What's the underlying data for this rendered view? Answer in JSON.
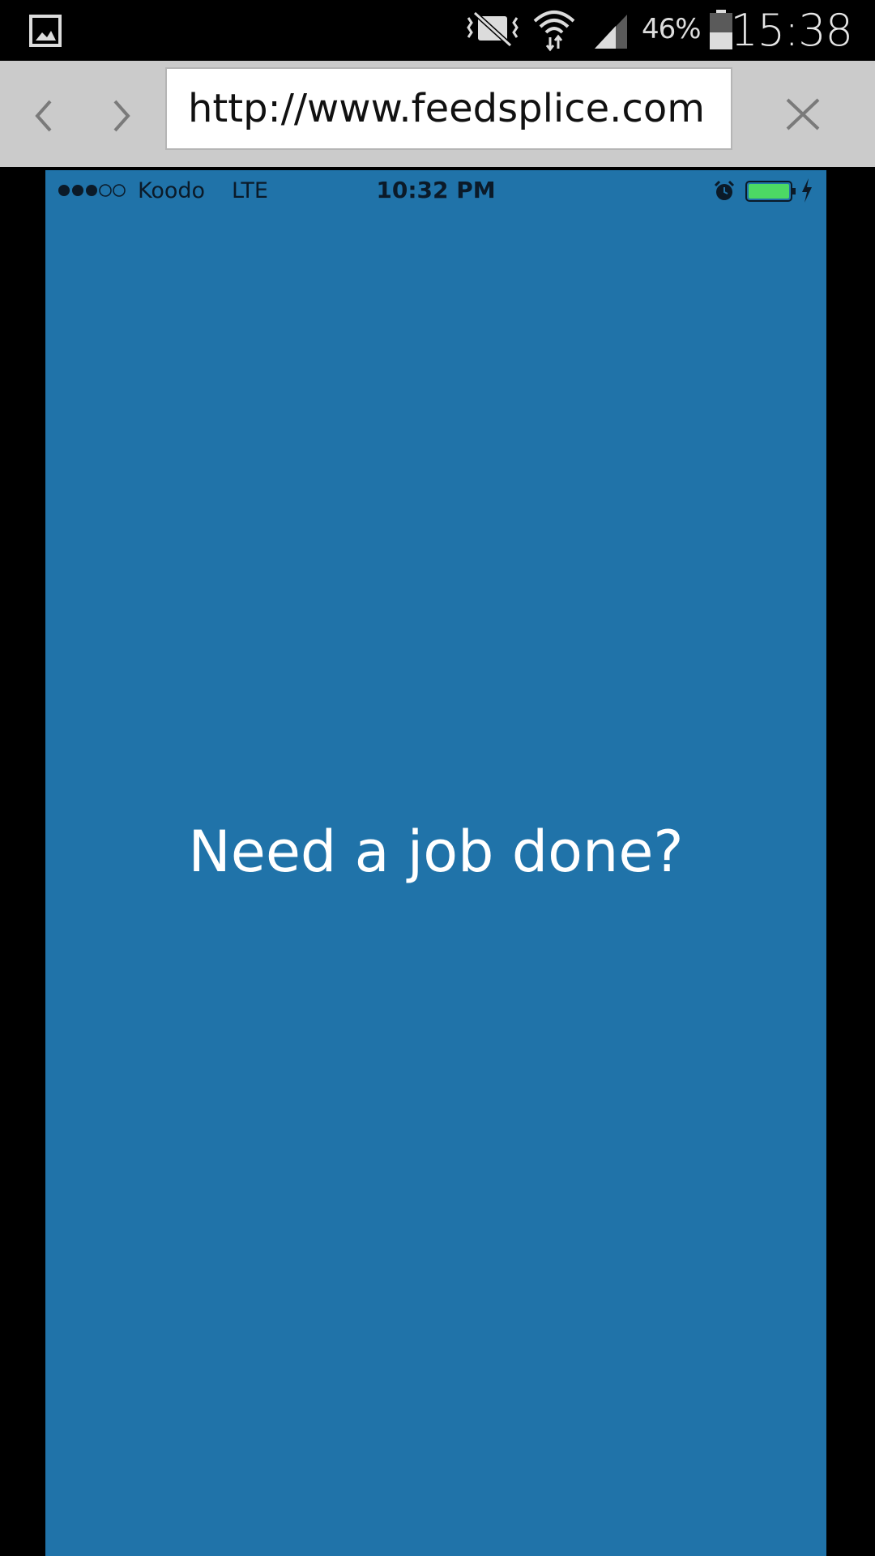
{
  "android_status": {
    "battery_percent": "46%",
    "time": "15:38",
    "battery_level": 0.46
  },
  "browser": {
    "url": "http://www.feedsplice.com"
  },
  "ios_status": {
    "carrier": "Koodo",
    "network": "LTE",
    "time": "10:32 PM",
    "signal_bars_filled": 3,
    "signal_bars_total": 5,
    "battery_color": "#4cd964"
  },
  "content": {
    "headline": "Need a job done?",
    "background_color": "#2073a9"
  }
}
